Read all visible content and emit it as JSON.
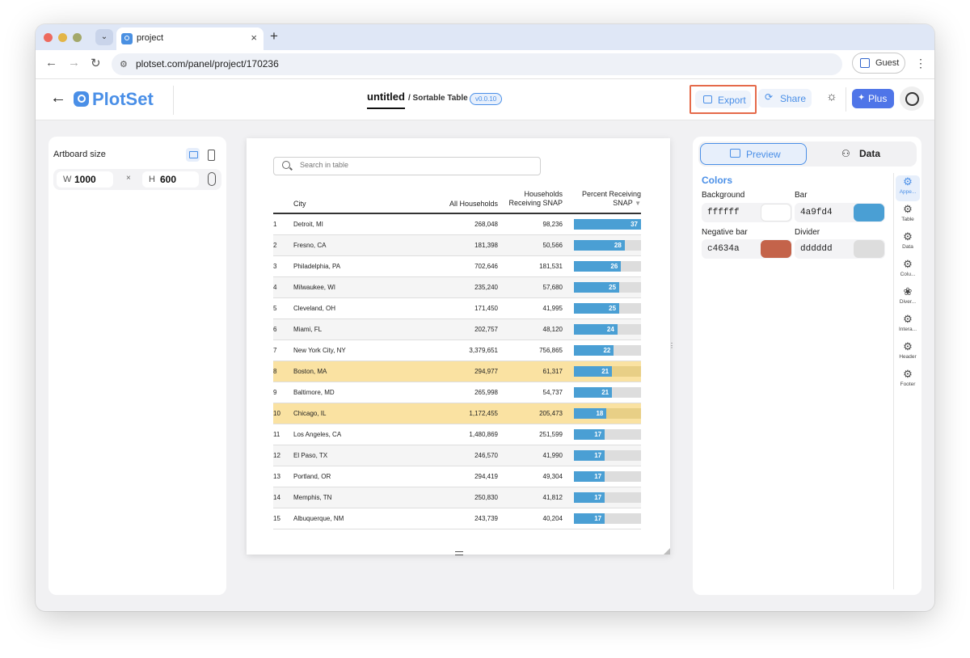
{
  "browser": {
    "tab_title": "project",
    "url": "plotset.com/panel/project/170236",
    "guest_label": "Guest",
    "new_tab": "+",
    "close": "×"
  },
  "header": {
    "logo": "PlotSet",
    "project_title": "untitled",
    "project_type": "/ Sortable Table",
    "version": "v0.0.10",
    "export_label": "Export",
    "share_label": "Share",
    "plus_label": "Plus"
  },
  "artboard_panel": {
    "title": "Artboard size",
    "width_label": "W",
    "width_value": "1000",
    "height_label": "H",
    "height_value": "600",
    "separator": "×"
  },
  "table": {
    "search_placeholder": "Search in table",
    "columns": [
      "City",
      "All Households",
      "Households Receiving SNAP",
      "Percent Receiving SNAP"
    ],
    "column_header_lines": {
      "households_line1": "Households",
      "households_line2": "Receiving SNAP",
      "percent_line1": "Percent Receiving",
      "percent_line2": "SNAP"
    },
    "sort_indicator": "▼",
    "bar_max": 37,
    "rows": [
      {
        "rank": "1",
        "city": "Detroit, MI",
        "all": "268,048",
        "snap": "98,236",
        "pct": "37",
        "pct_value": 37,
        "style": "plain"
      },
      {
        "rank": "2",
        "city": "Fresno, CA",
        "all": "181,398",
        "snap": "50,566",
        "pct": "28",
        "pct_value": 28,
        "style": "alt"
      },
      {
        "rank": "3",
        "city": "Philadelphia, PA",
        "all": "702,646",
        "snap": "181,531",
        "pct": "26",
        "pct_value": 26,
        "style": "plain"
      },
      {
        "rank": "4",
        "city": "Milwaukee, WI",
        "all": "235,240",
        "snap": "57,680",
        "pct": "25",
        "pct_value": 25,
        "style": "alt"
      },
      {
        "rank": "5",
        "city": "Cleveland, OH",
        "all": "171,450",
        "snap": "41,995",
        "pct": "25",
        "pct_value": 25,
        "style": "plain"
      },
      {
        "rank": "6",
        "city": "Miami, FL",
        "all": "202,757",
        "snap": "48,120",
        "pct": "24",
        "pct_value": 24,
        "style": "alt"
      },
      {
        "rank": "7",
        "city": "New York City, NY",
        "all": "3,379,651",
        "snap": "756,865",
        "pct": "22",
        "pct_value": 22,
        "style": "plain"
      },
      {
        "rank": "8",
        "city": "Boston, MA",
        "all": "294,977",
        "snap": "61,317",
        "pct": "21",
        "pct_value": 21,
        "style": "hl"
      },
      {
        "rank": "9",
        "city": "Baltimore, MD",
        "all": "265,998",
        "snap": "54,737",
        "pct": "21",
        "pct_value": 21,
        "style": "plain"
      },
      {
        "rank": "10",
        "city": "Chicago, IL",
        "all": "1,172,455",
        "snap": "205,473",
        "pct": "18",
        "pct_value": 18,
        "style": "hl"
      },
      {
        "rank": "11",
        "city": "Los Angeles, CA",
        "all": "1,480,869",
        "snap": "251,599",
        "pct": "17",
        "pct_value": 17,
        "style": "plain"
      },
      {
        "rank": "12",
        "city": "El Paso, TX",
        "all": "246,570",
        "snap": "41,990",
        "pct": "17",
        "pct_value": 17,
        "style": "alt"
      },
      {
        "rank": "13",
        "city": "Portland, OR",
        "all": "294,419",
        "snap": "49,304",
        "pct": "17",
        "pct_value": 17,
        "style": "plain"
      },
      {
        "rank": "14",
        "city": "Memphis, TN",
        "all": "250,830",
        "snap": "41,812",
        "pct": "17",
        "pct_value": 17,
        "style": "alt"
      },
      {
        "rank": "15",
        "city": "Albuquerque, NM",
        "all": "243,739",
        "snap": "40,204",
        "pct": "17",
        "pct_value": 17,
        "style": "plain"
      }
    ]
  },
  "settings": {
    "preview_tab": "Preview",
    "data_tab": "Data",
    "colors_title": "Colors",
    "colors": {
      "background": {
        "label": "Background",
        "hex": "ffffff",
        "color": "#ffffff"
      },
      "bar": {
        "label": "Bar",
        "hex": "4a9fd4",
        "color": "#4a9fd4"
      },
      "negative_bar": {
        "label": "Negative bar",
        "hex": "c4634a",
        "color": "#c4634a"
      },
      "divider": {
        "label": "Divider",
        "hex": "dddddd",
        "color": "#dddddd"
      }
    },
    "sidebar": [
      {
        "label": "Appe...",
        "icon": "gear-icon",
        "active": true
      },
      {
        "label": "Table",
        "icon": "gear-icon",
        "active": false
      },
      {
        "label": "Data",
        "icon": "gear-icon",
        "active": false
      },
      {
        "label": "Colu...",
        "icon": "gear-icon",
        "active": false
      },
      {
        "label": "Diver...",
        "icon": "diverging-icon",
        "active": false
      },
      {
        "label": "Intera...",
        "icon": "gear-icon",
        "active": false
      },
      {
        "label": "Header",
        "icon": "gear-icon",
        "active": false
      },
      {
        "label": "Footer",
        "icon": "gear-icon",
        "active": false
      }
    ]
  }
}
